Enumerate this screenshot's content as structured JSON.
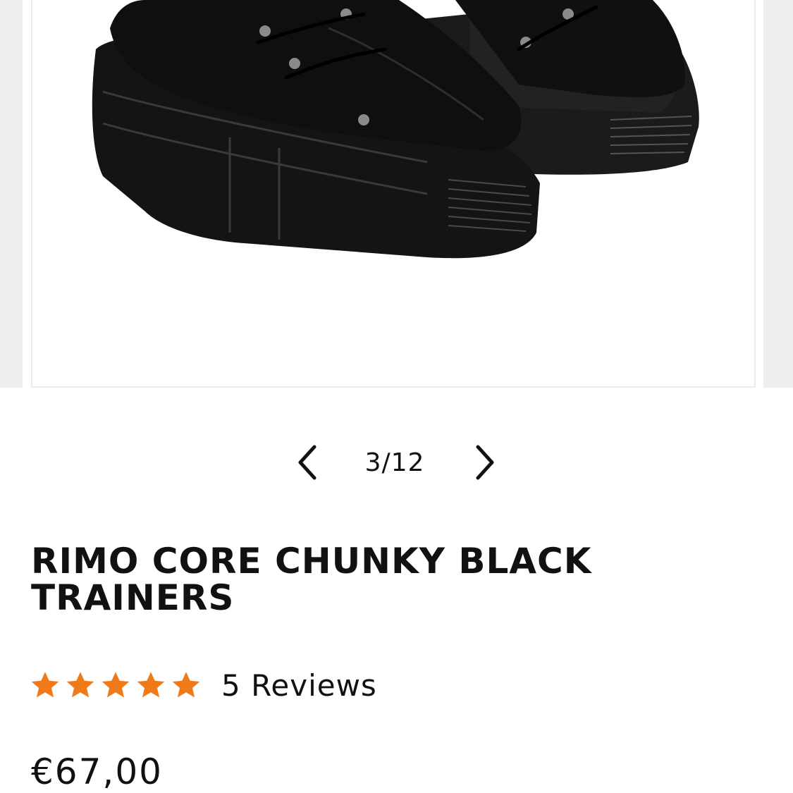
{
  "gallery": {
    "image_alt": "RIMO CORE CHUNKY BLACK TRAINERS",
    "counter": "3/12",
    "prev_icon": "chevron-left-icon",
    "next_icon": "chevron-right-icon"
  },
  "product": {
    "title": "RIMO CORE CHUNKY BLACK TRAINERS",
    "rating": {
      "stars": 5,
      "max": 5,
      "color": "#F07A1A"
    },
    "reviews_label": "5 Reviews",
    "price": "€67,00"
  },
  "colors": {
    "text": "#111111",
    "star": "#F07A1A",
    "slide_border": "#ECECEC",
    "side_panel": "#EEEEEE"
  }
}
